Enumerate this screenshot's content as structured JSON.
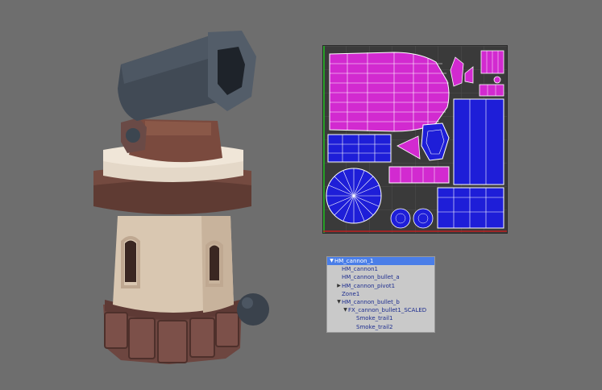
{
  "viewport": {
    "model": "cannon-tower",
    "colors": {
      "background": "#6e6e6e",
      "barrel": "#414a55",
      "bracket": "#7a4a3e",
      "ring": "#e4d8c8",
      "roof": "#744a40",
      "wall": "#d9c7b1",
      "base": "#6d4640",
      "ball": "#3a424c"
    }
  },
  "uv_editor": {
    "colors": {
      "magenta": "#d22ad0",
      "blue": "#1e1ed8",
      "wire": "#ffffff",
      "background": "#3a3a3a"
    }
  },
  "outliner": {
    "items": [
      {
        "label": "HM_cannon_1",
        "expander": "▼",
        "selected": true
      },
      {
        "label": "HM_cannon1",
        "expander": "",
        "selected": false
      },
      {
        "label": "HM_cannon_bullet_a",
        "expander": "",
        "selected": false
      },
      {
        "label": "HM_cannon_pivot1",
        "expander": "▶",
        "selected": false
      },
      {
        "label": "Zone1",
        "expander": "",
        "selected": false
      },
      {
        "label": "HM_cannon_bullet_b",
        "expander": "▼",
        "selected": false
      },
      {
        "label": "FX_cannon_bullet1_SCALED",
        "expander": "▼",
        "selected": false
      },
      {
        "label": "Smoke_trail1",
        "expander": "",
        "selected": false
      },
      {
        "label": "Smoke_trail2",
        "expander": "",
        "selected": false
      }
    ]
  }
}
